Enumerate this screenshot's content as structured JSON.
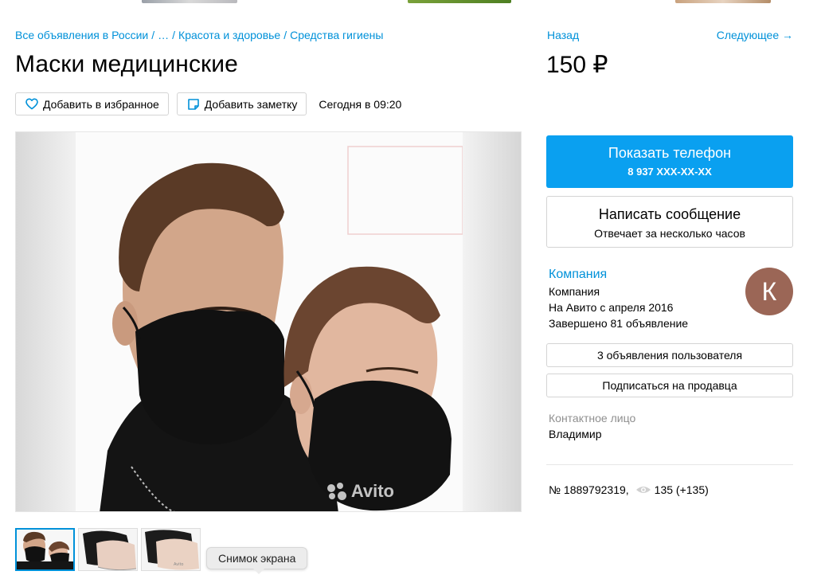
{
  "colors": {
    "link": "#0091d9",
    "primary_button": "#0aa0f0",
    "avatar_bg": "#9b6656"
  },
  "breadcrumbs": [
    {
      "label": "Все объявления в России"
    },
    {
      "label": "…"
    },
    {
      "label": "Красота и здоровье"
    },
    {
      "label": "Средства гигиены"
    }
  ],
  "nav": {
    "back_label": "Назад",
    "next_label": "Следующее →"
  },
  "listing": {
    "title": "Маски медицинские",
    "price": "150 ₽",
    "posted": "Сегодня в 09:20",
    "favorite_label": "Добавить в избранное",
    "note_label": "Добавить заметку",
    "watermark": "Avito",
    "number": "№ 1889792319,",
    "views": "135 (+135)"
  },
  "contact": {
    "phone_button_label": "Показать телефон",
    "phone_masked": "8 937 XXX-XX-XX",
    "message_button_label": "Написать сообщение",
    "message_button_sub": "Отвечает за несколько часов",
    "contact_label": "Контактное лицо",
    "contact_name": "Владимир"
  },
  "seller": {
    "name_link": "Компания",
    "type": "Компания",
    "since": "На Авито с апреля 2016",
    "completed": "Завершено 81 объявление",
    "avatar_letter": "К",
    "listings_button": "3 объявления пользователя",
    "subscribe_button": "Подписаться на продавца"
  },
  "tooltip": {
    "text": "Снимок экрана"
  },
  "icons": {
    "favorite": "heart-icon",
    "note": "note-icon",
    "views": "eye-icon"
  }
}
